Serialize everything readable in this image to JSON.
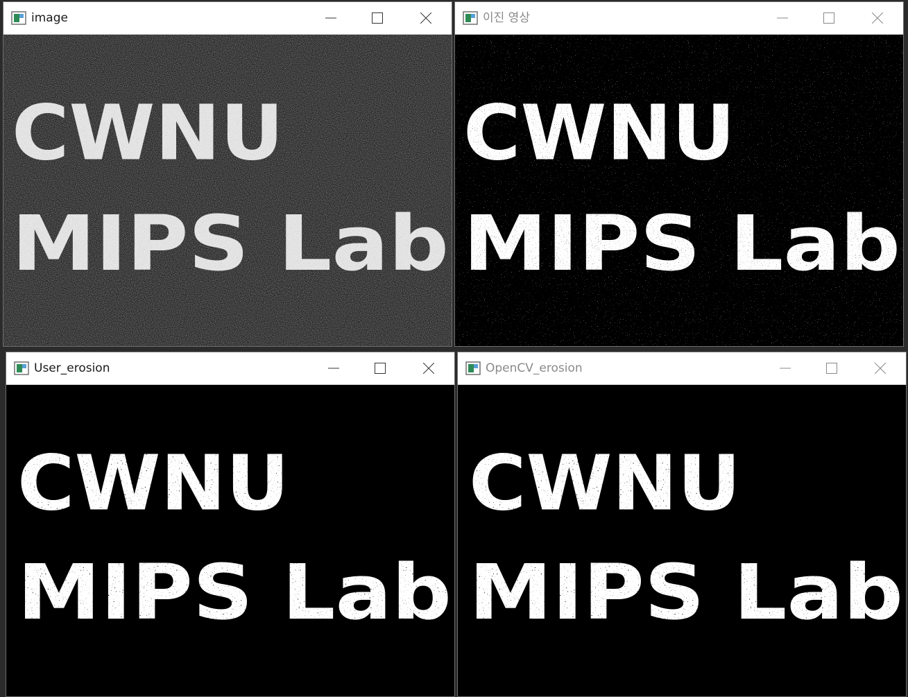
{
  "windows": [
    {
      "id": "image",
      "title": "image",
      "active": true,
      "style": "noisy-gray",
      "text_lines": [
        "CWNU",
        "MIPS Lab"
      ]
    },
    {
      "id": "binary",
      "title": "이진 영상",
      "active": false,
      "style": "binary-noise",
      "text_lines": [
        "CWNU",
        "MIPS Lab"
      ]
    },
    {
      "id": "user_erosion",
      "title": "User_erosion",
      "active": true,
      "style": "eroded",
      "text_lines": [
        "CWNU",
        "MIPS Lab"
      ]
    },
    {
      "id": "opencv_erosion",
      "title": "OpenCV_erosion",
      "active": false,
      "style": "eroded",
      "text_lines": [
        "CWNU",
        "MIPS Lab"
      ]
    }
  ],
  "controls": {
    "minimize_icon": "minimize-icon",
    "maximize_icon": "maximize-icon",
    "close_icon": "close-icon"
  },
  "colors": {
    "titlebar_bg": "#ffffff",
    "title_active": "#1a1a1a",
    "title_inactive": "#8a8a8a",
    "image_bg": "#000000",
    "text_fill": "#ffffff"
  }
}
